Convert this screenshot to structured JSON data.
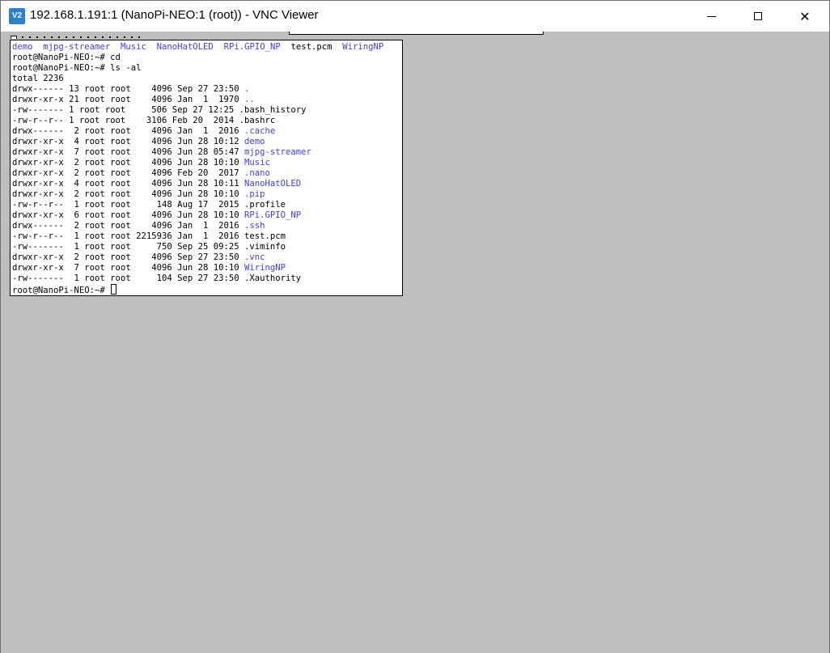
{
  "window": {
    "title": "192.168.1.191:1 (NanoPi-NEO:1 (root)) - VNC Viewer",
    "icon": "V2",
    "controls": [
      "minimize-icon",
      "maximize-icon",
      "close-icon"
    ],
    "close_glyph": "✕"
  },
  "terminal": {
    "lines": [
      [
        {
          "t": "demo",
          "c": "blue"
        },
        {
          "t": "  "
        },
        {
          "t": "mjpg-streamer",
          "c": "blue"
        },
        {
          "t": "  "
        },
        {
          "t": "Music",
          "c": "blue"
        },
        {
          "t": "  "
        },
        {
          "t": "NanoHatOLED",
          "c": "blue"
        },
        {
          "t": "  "
        },
        {
          "t": "RPi.GPIO_NP",
          "c": "blue"
        },
        {
          "t": "  test.pcm  "
        },
        {
          "t": "WiringNP",
          "c": "blue"
        }
      ],
      [
        {
          "t": "root@NanoPi-NEO:~# cd"
        }
      ],
      [
        {
          "t": "root@NanoPi-NEO:~# ls -al"
        }
      ],
      [
        {
          "t": "total 2236"
        }
      ],
      [
        {
          "t": "drwx------ 13 root root    4096 Sep 27 23:50 "
        },
        {
          "t": ".",
          "c": "blue"
        }
      ],
      [
        {
          "t": "drwxr-xr-x 21 root root    4096 Jan  1  1970 "
        },
        {
          "t": "..",
          "c": "blue"
        }
      ],
      [
        {
          "t": "-rw------- 1 root root     506 Sep 27 12:25 .bash_history"
        }
      ],
      [
        {
          "t": "-rw-r--r-- 1 root root    3106 Feb 20  2014 .bashrc"
        }
      ],
      [
        {
          "t": "drwx------  2 root root    4096 Jan  1  2016 "
        },
        {
          "t": ".cache",
          "c": "blue"
        }
      ],
      [
        {
          "t": "drwxr-xr-x  4 root root    4096 Jun 28 10:12 "
        },
        {
          "t": "demo",
          "c": "blue"
        }
      ],
      [
        {
          "t": "drwxr-xr-x  7 root root    4096 Jun 28 05:47 "
        },
        {
          "t": "mjpg-streamer",
          "c": "blue"
        }
      ],
      [
        {
          "t": "drwxr-xr-x  2 root root    4096 Jun 28 10:10 "
        },
        {
          "t": "Music",
          "c": "blue"
        }
      ],
      [
        {
          "t": "drwxr-xr-x  2 root root    4096 Feb 20  2017 "
        },
        {
          "t": ".nano",
          "c": "blue"
        }
      ],
      [
        {
          "t": "drwxr-xr-x  4 root root    4096 Jun 28 10:11 "
        },
        {
          "t": "NanoHatOLED",
          "c": "blue"
        }
      ],
      [
        {
          "t": "drwxr-xr-x  2 root root    4096 Jun 28 10:10 "
        },
        {
          "t": ".pip",
          "c": "blue"
        }
      ],
      [
        {
          "t": "-rw-r--r--  1 root root     148 Aug 17  2015 .profile"
        }
      ],
      [
        {
          "t": "drwxr-xr-x  6 root root    4096 Jun 28 10:10 "
        },
        {
          "t": "RPi.GPIO_NP",
          "c": "blue"
        }
      ],
      [
        {
          "t": "drwx------  2 root root    4096 Jan  1  2016 "
        },
        {
          "t": ".ssh",
          "c": "blue"
        }
      ],
      [
        {
          "t": "-rw-r--r--  1 root root 2215936 Jan  1  2016 test.pcm"
        }
      ],
      [
        {
          "t": "-rw-------  1 root root     750 Sep 25 09:25 .viminfo"
        }
      ],
      [
        {
          "t": "drwxr-xr-x  2 root root    4096 Sep 27 23:50 "
        },
        {
          "t": ".vnc",
          "c": "blue"
        }
      ],
      [
        {
          "t": "drwxr-xr-x  7 root root    4096 Jun 28 10:10 "
        },
        {
          "t": "WiringNP",
          "c": "blue"
        }
      ],
      [
        {
          "t": "-rw-------  1 root root     104 Sep 27 23:50 .Xauthority"
        }
      ],
      [
        {
          "t": "root@NanoPi-NEO:~# "
        }
      ]
    ]
  },
  "colors": {
    "desktop": "#bebebe",
    "directory": "#3d3dff",
    "terminal_bg": "#ffffff"
  }
}
